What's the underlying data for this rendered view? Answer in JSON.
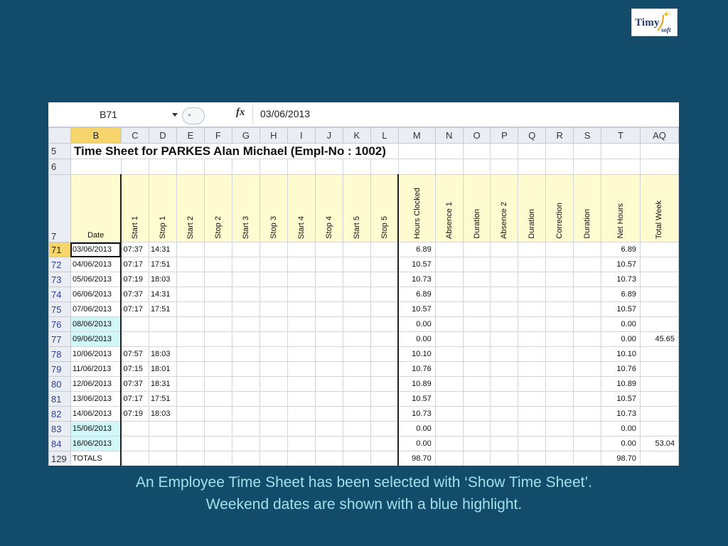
{
  "logo": {
    "main": "Timy",
    "sub": "soft"
  },
  "formula_bar": {
    "cell_ref": "B71",
    "fx_label": "fx",
    "value": "03/06/2013"
  },
  "columns": [
    "B",
    "C",
    "D",
    "E",
    "F",
    "G",
    "H",
    "I",
    "J",
    "K",
    "L",
    "M",
    "N",
    "O",
    "P",
    "Q",
    "R",
    "S",
    "T",
    "AQ"
  ],
  "rows": {
    "title_row_num": "5",
    "title": "Time Sheet for PARKES Alan Michael (Empl-No : 1002)",
    "blank_row_num": "6",
    "header_row_num": "7",
    "header_date": "Date",
    "headers": [
      "Start 1",
      "Stop 1",
      "Start 2",
      "Stop 2",
      "Start 3",
      "Stop 3",
      "Start 4",
      "Stop 4",
      "Start 5",
      "Stop 5",
      "Hours Clocked",
      "Absence 1",
      "Duration",
      "Absence 2",
      "Duration",
      "Correction",
      "Duration",
      "Net Hours",
      "Total Week"
    ]
  },
  "entries": [
    {
      "row": "71",
      "date": "03/06/2013",
      "start1": "07:37",
      "stop1": "14:31",
      "hours": "6.89",
      "net": "6.89",
      "week": "",
      "weekend": false,
      "selected": true
    },
    {
      "row": "72",
      "date": "04/06/2013",
      "start1": "07:17",
      "stop1": "17:51",
      "hours": "10.57",
      "net": "10.57",
      "week": "",
      "weekend": false
    },
    {
      "row": "73",
      "date": "05/06/2013",
      "start1": "07:19",
      "stop1": "18:03",
      "hours": "10.73",
      "net": "10.73",
      "week": "",
      "weekend": false
    },
    {
      "row": "74",
      "date": "06/06/2013",
      "start1": "07:37",
      "stop1": "14:31",
      "hours": "6.89",
      "net": "6.89",
      "week": "",
      "weekend": false
    },
    {
      "row": "75",
      "date": "07/06/2013",
      "start1": "07:17",
      "stop1": "17:51",
      "hours": "10.57",
      "net": "10.57",
      "week": "",
      "weekend": false
    },
    {
      "row": "76",
      "date": "08/06/2013",
      "start1": "",
      "stop1": "",
      "hours": "0.00",
      "net": "0.00",
      "week": "",
      "weekend": true
    },
    {
      "row": "77",
      "date": "09/06/2013",
      "start1": "",
      "stop1": "",
      "hours": "0.00",
      "net": "0.00",
      "week": "45.65",
      "weekend": true
    },
    {
      "row": "78",
      "date": "10/06/2013",
      "start1": "07:57",
      "stop1": "18:03",
      "hours": "10.10",
      "net": "10.10",
      "week": "",
      "weekend": false
    },
    {
      "row": "79",
      "date": "11/06/2013",
      "start1": "07:15",
      "stop1": "18:01",
      "hours": "10.76",
      "net": "10.76",
      "week": "",
      "weekend": false
    },
    {
      "row": "80",
      "date": "12/06/2013",
      "start1": "07:37",
      "stop1": "18:31",
      "hours": "10.89",
      "net": "10.89",
      "week": "",
      "weekend": false
    },
    {
      "row": "81",
      "date": "13/06/2013",
      "start1": "07:17",
      "stop1": "17:51",
      "hours": "10.57",
      "net": "10.57",
      "week": "",
      "weekend": false
    },
    {
      "row": "82",
      "date": "14/06/2013",
      "start1": "07:19",
      "stop1": "18:03",
      "hours": "10.73",
      "net": "10.73",
      "week": "",
      "weekend": false
    },
    {
      "row": "83",
      "date": "15/06/2013",
      "start1": "",
      "stop1": "",
      "hours": "0.00",
      "net": "0.00",
      "week": "",
      "weekend": true
    },
    {
      "row": "84",
      "date": "16/06/2013",
      "start1": "",
      "stop1": "",
      "hours": "0.00",
      "net": "0.00",
      "week": "53.04",
      "weekend": true
    }
  ],
  "totals": {
    "row": "129",
    "label": "TOTALS",
    "hours": "98.70",
    "net": "98.70"
  },
  "caption": {
    "line1": "An Employee Time Sheet has been selected with ‘Show Time Sheet’.",
    "line2": "Weekend dates are shown with a blue highlight."
  },
  "colors": {
    "background": "#134c6a",
    "caption": "#9ee3ec",
    "weekend_highlight": "#d1f7f9",
    "header_fill": "#fdfbcf",
    "selected_header": "#f7d56d"
  }
}
